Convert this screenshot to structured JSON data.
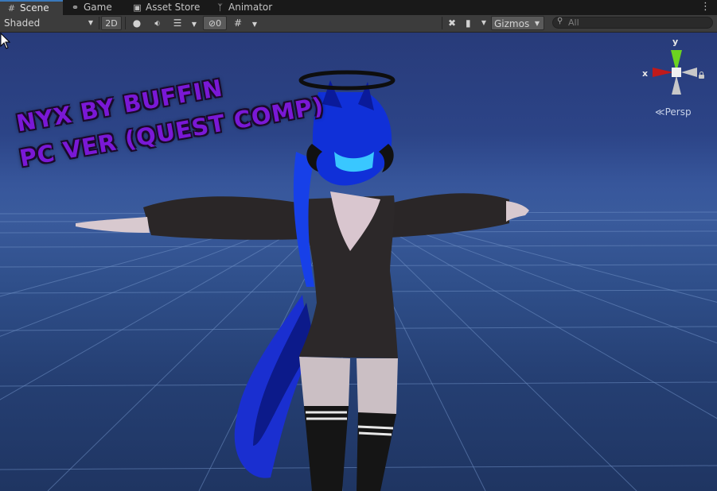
{
  "tabs": [
    {
      "label": "Scene",
      "icon": "grid-icon",
      "active": true
    },
    {
      "label": "Game",
      "icon": "gamepad-icon",
      "active": false
    },
    {
      "label": "Asset Store",
      "icon": "bag-icon",
      "active": false
    },
    {
      "label": "Animator",
      "icon": "animator-icon",
      "active": false
    }
  ],
  "toolbar": {
    "draw_mode": "Shaded",
    "mode_2d": "2D",
    "hidden_count": "0",
    "gizmos": "Gizmos",
    "search_placeholder": "All"
  },
  "scene": {
    "overlay_line1": "NYX BY BUFFIN",
    "overlay_line2": "PC VER (QUEST COMP)",
    "projection": "Persp",
    "axis_y": "y",
    "axis_x": "x",
    "colors": {
      "sky_top": "#283b7a",
      "horizon": "#3a5b9d",
      "ground": "#1f3562",
      "overlay_text": "#7a18d6",
      "axis_y": "#6cd420",
      "axis_x": "#c01a1a"
    }
  }
}
